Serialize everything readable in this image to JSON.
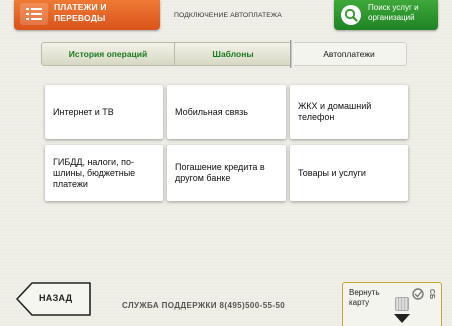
{
  "header": {
    "payments_button": {
      "label": "Платежи и переводы",
      "icon": "list-icon"
    },
    "title": "Подключение автоплатежа",
    "search_button": {
      "label": "Поиск услуг и организаций",
      "icon": "search-icon"
    }
  },
  "tabs": [
    {
      "label": "История операций",
      "active": false
    },
    {
      "label": "Шаблоны",
      "active": false
    },
    {
      "label": "Автоплатежи",
      "active": true
    }
  ],
  "categories": [
    "Интернет и ТВ",
    "Мобильная связь",
    "ЖКХ и домашний телефон",
    "ГИБДД, налоги, по-шлины, бюджетные платежи",
    "Погашение кредита в другом банке",
    "Товары и услуги"
  ],
  "footer": {
    "back_label": "НАЗАД",
    "support_text": "СЛУЖБА ПОДДЕРЖКИ 8(495)500-55-50",
    "card_return_label": "Вернуть карту",
    "card_logo_text": "СБ"
  },
  "colors": {
    "orange": "#e2642a",
    "green": "#2f9a2f",
    "tab_text_green": "#1d7a21"
  }
}
